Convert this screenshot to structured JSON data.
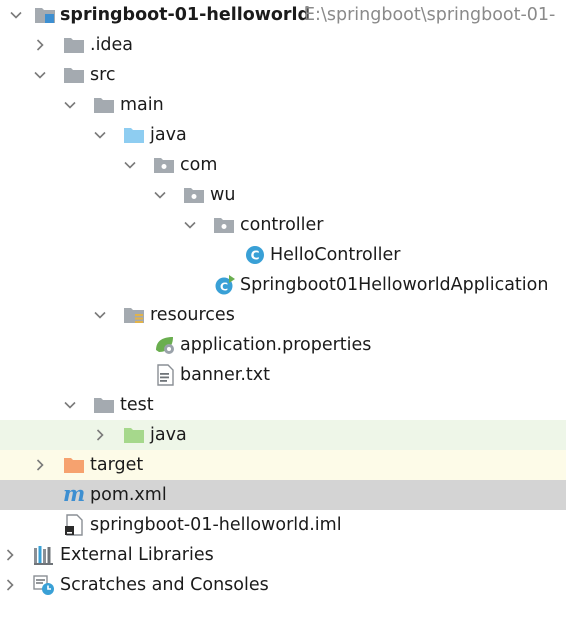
{
  "tree": {
    "root": {
      "label": "springboot-01-helloworld",
      "path": "E:\\springboot\\springboot-01-"
    },
    "idea": {
      "label": ".idea"
    },
    "src": {
      "label": "src"
    },
    "main": {
      "label": "main"
    },
    "java": {
      "label": "java"
    },
    "com": {
      "label": "com"
    },
    "wu": {
      "label": "wu"
    },
    "controller": {
      "label": "controller"
    },
    "hello_controller": {
      "label": "HelloController"
    },
    "application": {
      "label": "Springboot01HelloworldApplication"
    },
    "resources": {
      "label": "resources"
    },
    "app_properties": {
      "label": "application.properties"
    },
    "banner": {
      "label": "banner.txt"
    },
    "test": {
      "label": "test"
    },
    "test_java": {
      "label": "java"
    },
    "target": {
      "label": "target"
    },
    "pom": {
      "label": "pom.xml",
      "icon_letter": "m"
    },
    "iml": {
      "label": "springboot-01-helloworld.iml"
    },
    "ext_libs": {
      "label": "External Libraries"
    },
    "scratches": {
      "label": "Scratches and Consoles"
    }
  },
  "colors": {
    "folder_gray": "#a4aab0",
    "source_blue": "#8ecdf1",
    "test_green": "#a6d88c",
    "excluded_orange": "#f6a26f",
    "class_blue": "#39a0d6",
    "spring_green": "#6aae4f",
    "maven_blue": "#3d8fd1",
    "selected_bg": "#d4d4d4",
    "green_row_bg": "#eef6e8",
    "yellow_row_bg": "#fdfbe8"
  }
}
